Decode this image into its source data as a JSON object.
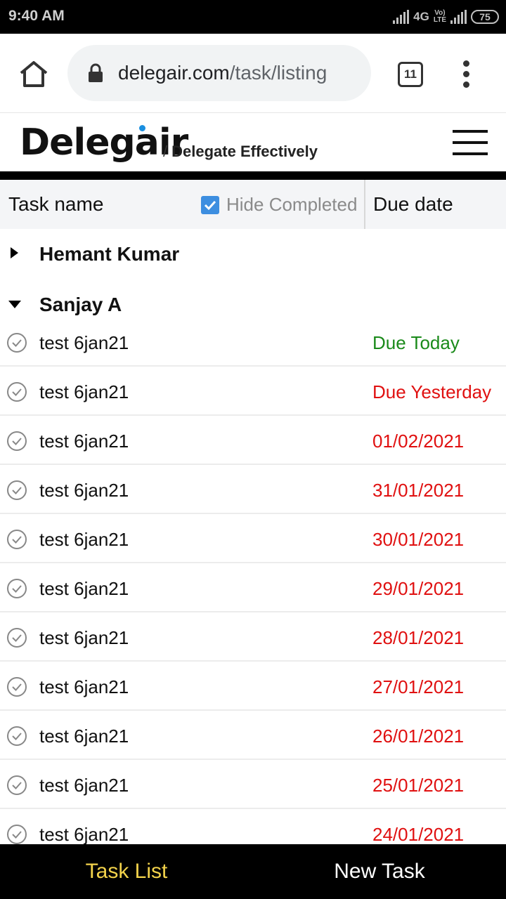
{
  "status_bar": {
    "time": "9:40 AM",
    "network": "4G",
    "volte": [
      "Vo)",
      "LTE"
    ],
    "battery": "75"
  },
  "browser": {
    "url_domain": "delegair.com",
    "url_path": "/task/listing",
    "tab_count": "11"
  },
  "app": {
    "logo": "Delegair",
    "tagline": "Delegate Effectively",
    "tagline_slash": "/",
    "brand_dot_color": "#1a8fe0"
  },
  "columns": {
    "task_name": "Task name",
    "hide_completed": "Hide Completed",
    "hide_completed_checked": true,
    "due_date": "Due date"
  },
  "groups": [
    {
      "name": "Hemant Kumar",
      "expanded": false
    },
    {
      "name": "Sanjay A",
      "expanded": true
    }
  ],
  "tasks": [
    {
      "name": "test 6jan21",
      "due": "Due Today",
      "due_color": "#1a8a1a"
    },
    {
      "name": "test 6jan21",
      "due": "Due Yesterday",
      "due_color": "#e01010"
    },
    {
      "name": "test 6jan21",
      "due": "01/02/2021",
      "due_color": "#e01010"
    },
    {
      "name": "test 6jan21",
      "due": "31/01/2021",
      "due_color": "#e01010"
    },
    {
      "name": "test 6jan21",
      "due": "30/01/2021",
      "due_color": "#e01010"
    },
    {
      "name": "test 6jan21",
      "due": "29/01/2021",
      "due_color": "#e01010"
    },
    {
      "name": "test 6jan21",
      "due": "28/01/2021",
      "due_color": "#e01010"
    },
    {
      "name": "test 6jan21",
      "due": "27/01/2021",
      "due_color": "#e01010"
    },
    {
      "name": "test 6jan21",
      "due": "26/01/2021",
      "due_color": "#e01010"
    },
    {
      "name": "test 6jan21",
      "due": "25/01/2021",
      "due_color": "#e01010"
    },
    {
      "name": "test 6jan21",
      "due": "24/01/2021",
      "due_color": "#e01010"
    }
  ],
  "bottom_nav": {
    "items": [
      {
        "label": "Task List",
        "active": true,
        "color": "#f2d24b"
      },
      {
        "label": "New Task",
        "active": false,
        "color": "#ffffff"
      }
    ]
  }
}
